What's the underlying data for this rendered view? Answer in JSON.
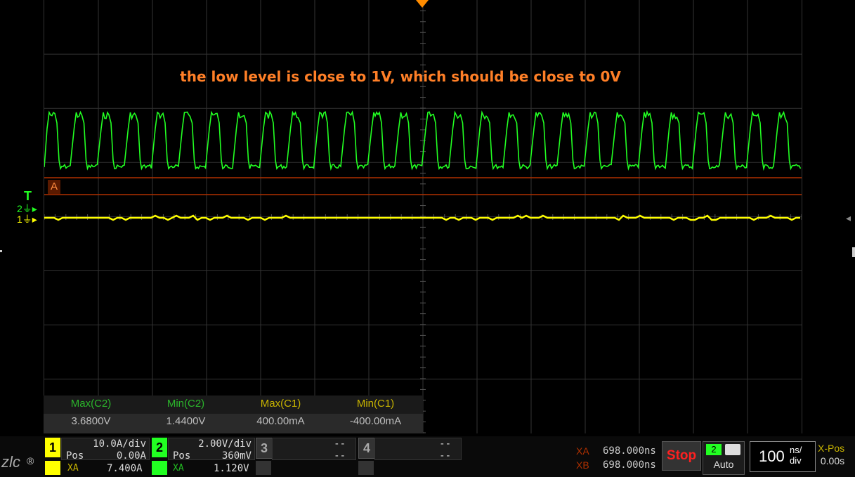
{
  "annotation": "the low level is close to 1V, which should be close to 0V",
  "markers": {
    "trigger_label": "T",
    "ch2_label": "2",
    "ch1_label": "1",
    "cursor_a_label": "A"
  },
  "measurements": {
    "headers": [
      "Max(C2)",
      "Min(C2)",
      "Max(C1)",
      "Min(C1)"
    ],
    "values": [
      "3.6800V",
      "1.4400V",
      "400.00mA",
      "-400.00mA"
    ],
    "header_colors": [
      "#2bb52b",
      "#2bb52b",
      "#c8b400",
      "#c8b400"
    ]
  },
  "channels": {
    "ch1": {
      "num": "1",
      "scale": "10.0A/div",
      "pos_label": "Pos",
      "pos": "0.00A",
      "xa_label": "XA",
      "xa": "7.400A",
      "color": "#ffff00"
    },
    "ch2": {
      "num": "2",
      "scale": "2.00V/div",
      "pos_label": "Pos",
      "pos": "360mV",
      "xa_label": "XA",
      "xa": "1.120V",
      "color": "#22ff22"
    },
    "ch3": {
      "num": "3",
      "scale": "--",
      "pos": "--"
    },
    "ch4": {
      "num": "4",
      "scale": "--",
      "pos": "--"
    }
  },
  "cursors": {
    "xa_label": "XA",
    "xa": "698.000ns",
    "xb_label": "XB",
    "xb": "698.000ns"
  },
  "run_state": "Stop",
  "trigger": {
    "channel": "2",
    "mode": "Auto"
  },
  "timebase": {
    "value": "100",
    "unit": "ns/",
    "unit2": "div"
  },
  "xpos": {
    "label": "X-Pos",
    "value": "0.00s"
  },
  "brand_mark": "®",
  "colors": {
    "ch1": "#ffff00",
    "ch2": "#22ff22",
    "annotation": "#ff7f27",
    "cursor": "#b03000",
    "grid": "#3a3a3a"
  }
}
